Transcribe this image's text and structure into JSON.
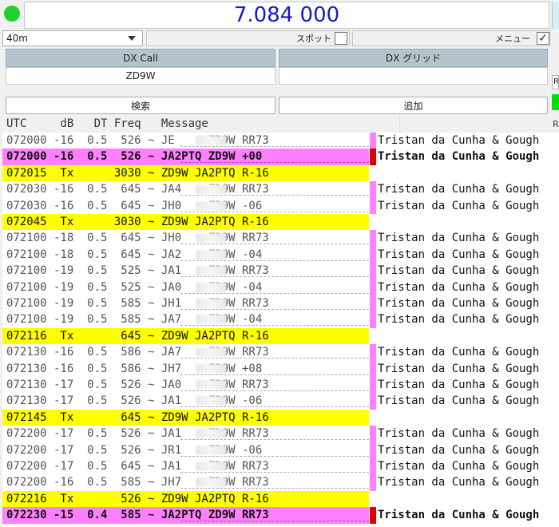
{
  "header": {
    "frequency": "7.084 000"
  },
  "controls": {
    "band": "40m",
    "spot_label": "スポット",
    "menu_label": "メニュー",
    "menu_checked": "✓"
  },
  "dx": {
    "call_label": "DX Call",
    "call_value": "ZD9W",
    "grid_label": "DX グリッド",
    "grid_value": ""
  },
  "buttons": {
    "search": "検索",
    "add": "追加"
  },
  "side": {
    "r_label": "R"
  },
  "log": {
    "columns": "UTC     dB   DT Freq   Message",
    "right_label": "R",
    "rows": [
      {
        "kind": "rx",
        "text": "072000 -16  0.5  526 ~ JE     ZD9W RR73",
        "country": "Tristan da Cunha & Gough"
      },
      {
        "kind": "mine",
        "text": "072000 -16  0.5  526 ~ JA2PTQ ZD9W +00",
        "country": "Tristan da Cunha & Gough"
      },
      {
        "kind": "tx",
        "text": "072015  Tx      3030 ~ ZD9W JA2PTQ R-16",
        "country": ""
      },
      {
        "kind": "rx",
        "text": "072030 -16  0.5  645 ~ JA4    ZD9W RR73",
        "country": "Tristan da Cunha & Gough"
      },
      {
        "kind": "rx",
        "text": "072030 -16  0.5  645 ~ JH0    ZD9W -06",
        "country": "Tristan da Cunha & Gough"
      },
      {
        "kind": "tx",
        "text": "072045  Tx      3030 ~ ZD9W JA2PTQ R-16",
        "country": ""
      },
      {
        "kind": "rx",
        "text": "072100 -18  0.5  645 ~ JH0    ZD9W RR73",
        "country": "Tristan da Cunha & Gough"
      },
      {
        "kind": "rx",
        "text": "072100 -18  0.5  645 ~ JA2    ZD9W -04",
        "country": "Tristan da Cunha & Gough"
      },
      {
        "kind": "rx",
        "text": "072100 -19  0.5  525 ~ JA1    ZD9W RR73",
        "country": "Tristan da Cunha & Gough"
      },
      {
        "kind": "rx",
        "text": "072100 -19  0.5  525 ~ JA0    ZD9W -04",
        "country": "Tristan da Cunha & Gough"
      },
      {
        "kind": "rx",
        "text": "072100 -19  0.5  585 ~ JH1    ZD9W RR73",
        "country": "Tristan da Cunha & Gough"
      },
      {
        "kind": "rx",
        "text": "072100 -19  0.5  585 ~ JA7    ZD9W -04",
        "country": "Tristan da Cunha & Gough"
      },
      {
        "kind": "tx",
        "text": "072116  Tx       645 ~ ZD9W JA2PTQ R-16",
        "country": ""
      },
      {
        "kind": "rx",
        "text": "072130 -16  0.5  586 ~ JA7    ZD9W RR73",
        "country": "Tristan da Cunha & Gough"
      },
      {
        "kind": "rx",
        "text": "072130 -16  0.5  586 ~ JH7    ZD9W +08",
        "country": "Tristan da Cunha & Gough"
      },
      {
        "kind": "rx",
        "text": "072130 -17  0.5  526 ~ JA0    ZD9W RR73",
        "country": "Tristan da Cunha & Gough"
      },
      {
        "kind": "rx",
        "text": "072130 -17  0.5  526 ~ JA1    ZD9W -06",
        "country": "Tristan da Cunha & Gough"
      },
      {
        "kind": "tx",
        "text": "072145  Tx       645 ~ ZD9W JA2PTQ R-16",
        "country": ""
      },
      {
        "kind": "rx",
        "text": "072200 -17  0.5  526 ~ JA1    ZD9W RR73",
        "country": "Tristan da Cunha & Gough"
      },
      {
        "kind": "rx",
        "text": "072200 -17  0.5  526 ~ JR1    ZD9W -06",
        "country": "Tristan da Cunha & Gough"
      },
      {
        "kind": "rx",
        "text": "072200 -17  0.5  645 ~ JA1    ZD9W RR73",
        "country": "Tristan da Cunha & Gough"
      },
      {
        "kind": "rx",
        "text": "072200 -16  0.5  585 ~ JH7    ZD9W RR73",
        "country": "Tristan da Cunha & Gough"
      },
      {
        "kind": "tx",
        "text": "072216  Tx       526 ~ ZD9W JA2PTQ R-16",
        "country": ""
      },
      {
        "kind": "mine",
        "text": "072230 -15  0.4  585 ~ JA2PTQ ZD9W RR73",
        "country": "Tristan da Cunha & Gough"
      }
    ]
  }
}
